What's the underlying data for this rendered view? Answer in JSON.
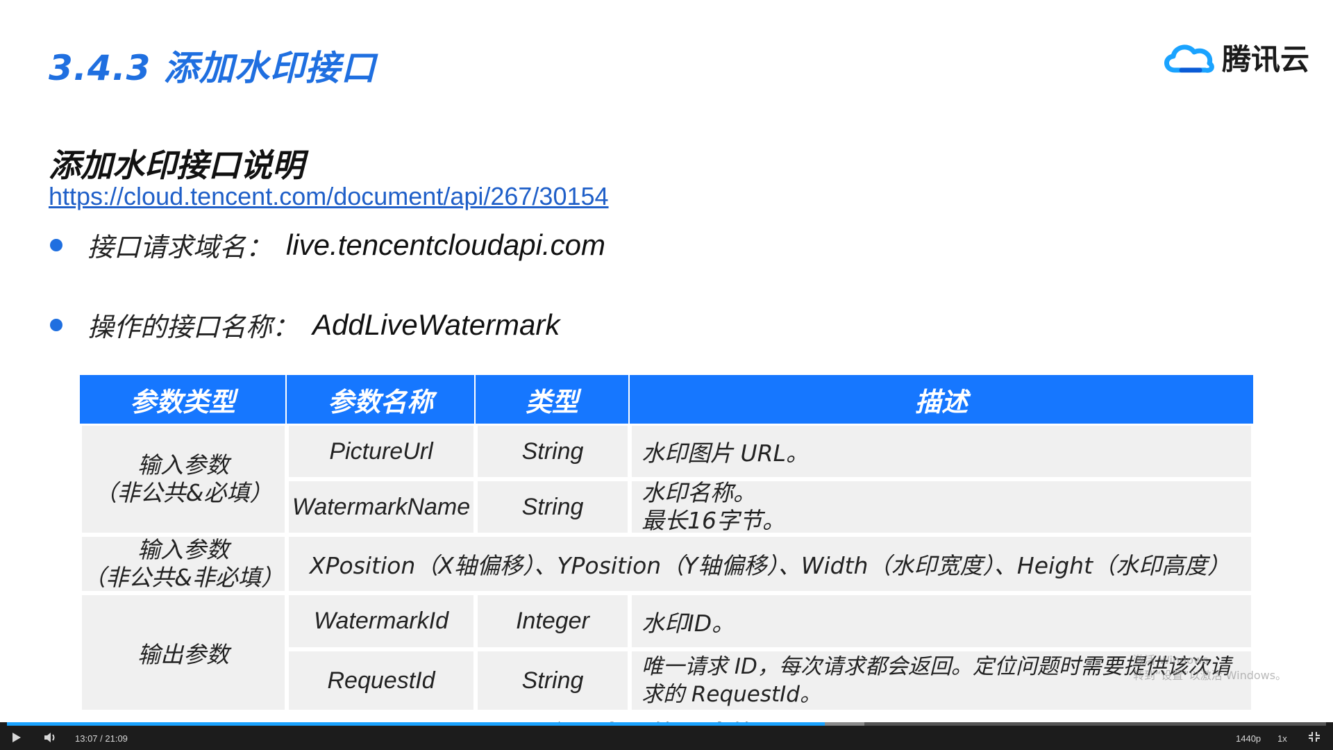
{
  "slide": {
    "section_title": "3.4.3  添加水印接口",
    "logo_text": "腾讯云",
    "heading": "添加水印接口说明",
    "link": "https://cloud.tencent.com/document/api/267/30154",
    "bullets": [
      {
        "label": "接口请求域名：",
        "value": "live.tencentcloudapi.com"
      },
      {
        "label": "操作的接口名称：",
        "value": "AddLiveWatermark"
      }
    ]
  },
  "table": {
    "headers": [
      "参数类型",
      "参数名称",
      "类型",
      "描述"
    ],
    "group1": {
      "line1": "输入参数",
      "line2": "（非公共&必填）"
    },
    "group2": {
      "line1": "输入参数",
      "line2": "（非公共&非必填）"
    },
    "group3": "输出参数",
    "rows": [
      {
        "name": "PictureUrl",
        "type": "String",
        "desc1": "水印图片 URL。",
        "desc2": ""
      },
      {
        "name": "WatermarkName",
        "type": "String",
        "desc1": "水印名称。",
        "desc2": "最长16字节。"
      },
      {
        "name": "WatermarkId",
        "type": "Integer",
        "desc1": "水印ID。",
        "desc2": ""
      },
      {
        "name": "RequestId",
        "type": "String",
        "desc1": "唯一请求 ID，每次请求都会返回。定位问题时需要提供该次请",
        "desc2": "求的 RequestId。"
      }
    ],
    "optional_params": "XPosition（X轴偏移）、YPosition（Y轴偏移）、Width（水印宽度）、Height（水印高度）"
  },
  "watermark": {
    "line1": "激活 Windows",
    "line2": "转到“设置”以激活 Windows。"
  },
  "subtitle": "一个是水印的图片的 URL",
  "player": {
    "time": "13:07 / 21:09",
    "quality": "1440p",
    "speed": "1x",
    "played_fraction": 0.62,
    "buffered_fraction": 0.65,
    "accent_color": "#1aa3ff"
  }
}
